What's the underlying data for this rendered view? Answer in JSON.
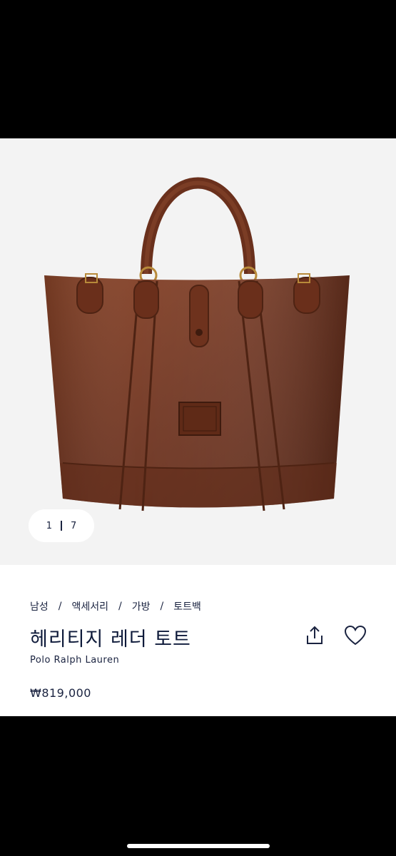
{
  "gallery": {
    "current": "1",
    "total": "7",
    "image_alt": "Brown leather tote bag"
  },
  "product": {
    "breadcrumb": [
      "남성",
      "액세서리",
      "가방",
      "토트백"
    ],
    "breadcrumb_separator": "/",
    "title": "헤리티지 레더 토트",
    "brand": "Polo Ralph Lauren",
    "price": "₩819,000"
  },
  "icons": {
    "share": "share-icon",
    "wishlist": "heart-icon"
  },
  "colors": {
    "text": "#1a2340",
    "leather": "#7a3a22"
  }
}
